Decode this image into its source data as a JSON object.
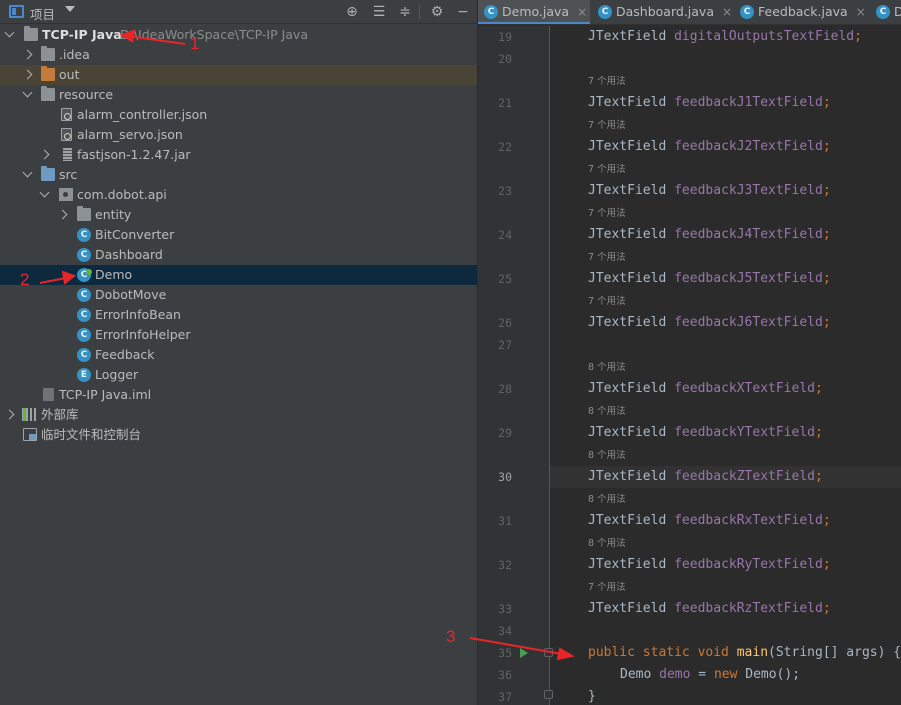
{
  "project_panel": {
    "title": "项目",
    "tree": [
      {
        "label": "TCP-IP Java",
        "extra": "D:\\IdeaWorkSpace\\TCP-IP Java"
      },
      {
        "label": ".idea"
      },
      {
        "label": "out"
      },
      {
        "label": "resource"
      },
      {
        "label": "alarm_controller.json"
      },
      {
        "label": "alarm_servo.json"
      },
      {
        "label": "fastjson-1.2.47.jar"
      },
      {
        "label": "src"
      },
      {
        "label": "com.dobot.api"
      },
      {
        "label": "entity"
      },
      {
        "label": "BitConverter"
      },
      {
        "label": "Dashboard"
      },
      {
        "label": "Demo"
      },
      {
        "label": "DobotMove"
      },
      {
        "label": "ErrorInfoBean"
      },
      {
        "label": "ErrorInfoHelper"
      },
      {
        "label": "Feedback"
      },
      {
        "label": "Logger"
      },
      {
        "label": "TCP-IP Java.iml"
      },
      {
        "label": "外部库"
      },
      {
        "label": "临时文件和控制台"
      }
    ],
    "class_badge": "C",
    "enum_badge": "E"
  },
  "editor": {
    "tabs": [
      {
        "label": "Demo.java"
      },
      {
        "label": "Dashboard.java"
      },
      {
        "label": "Feedback.java"
      },
      {
        "label": "Do"
      }
    ],
    "close_glyph": "×",
    "usage_7": "7 个用法",
    "usage_8": "8 个用法",
    "type_name": "JTextField",
    "lines": [
      {
        "n": "19",
        "field": "digitalOutputsTextField"
      },
      {
        "n": "20"
      },
      {
        "n": "21",
        "field": "feedbackJ1TextField"
      },
      {
        "n": "22",
        "field": "feedbackJ2TextField"
      },
      {
        "n": "23",
        "field": "feedbackJ3TextField"
      },
      {
        "n": "24",
        "field": "feedbackJ4TextField"
      },
      {
        "n": "25",
        "field": "feedbackJ5TextField"
      },
      {
        "n": "26",
        "field": "feedbackJ6TextField"
      },
      {
        "n": "27"
      },
      {
        "n": "28",
        "field": "feedbackXTextField"
      },
      {
        "n": "29",
        "field": "feedbackYTextField"
      },
      {
        "n": "30",
        "field": "feedbackZTextField"
      },
      {
        "n": "31",
        "field": "feedbackRxTextField"
      },
      {
        "n": "32",
        "field": "feedbackRyTextField"
      },
      {
        "n": "33",
        "field": "feedbackRzTextField"
      },
      {
        "n": "34"
      },
      {
        "n": "35"
      },
      {
        "n": "36"
      },
      {
        "n": "37"
      }
    ],
    "main_sig": {
      "kw": "public static void",
      "fn": "main",
      "rest": "(String[] args) {"
    },
    "demo_line": {
      "type": "Demo",
      "var": "demo",
      "eq": " = ",
      "kw": "new",
      "rest": " Demo();"
    },
    "close_brace": "}",
    "semicolon": ";"
  },
  "annotations": [
    "1",
    "2",
    "3"
  ],
  "colors": {
    "annotation": "#e8262a",
    "selection": "#0d293e",
    "accent": "#4a88c7"
  }
}
